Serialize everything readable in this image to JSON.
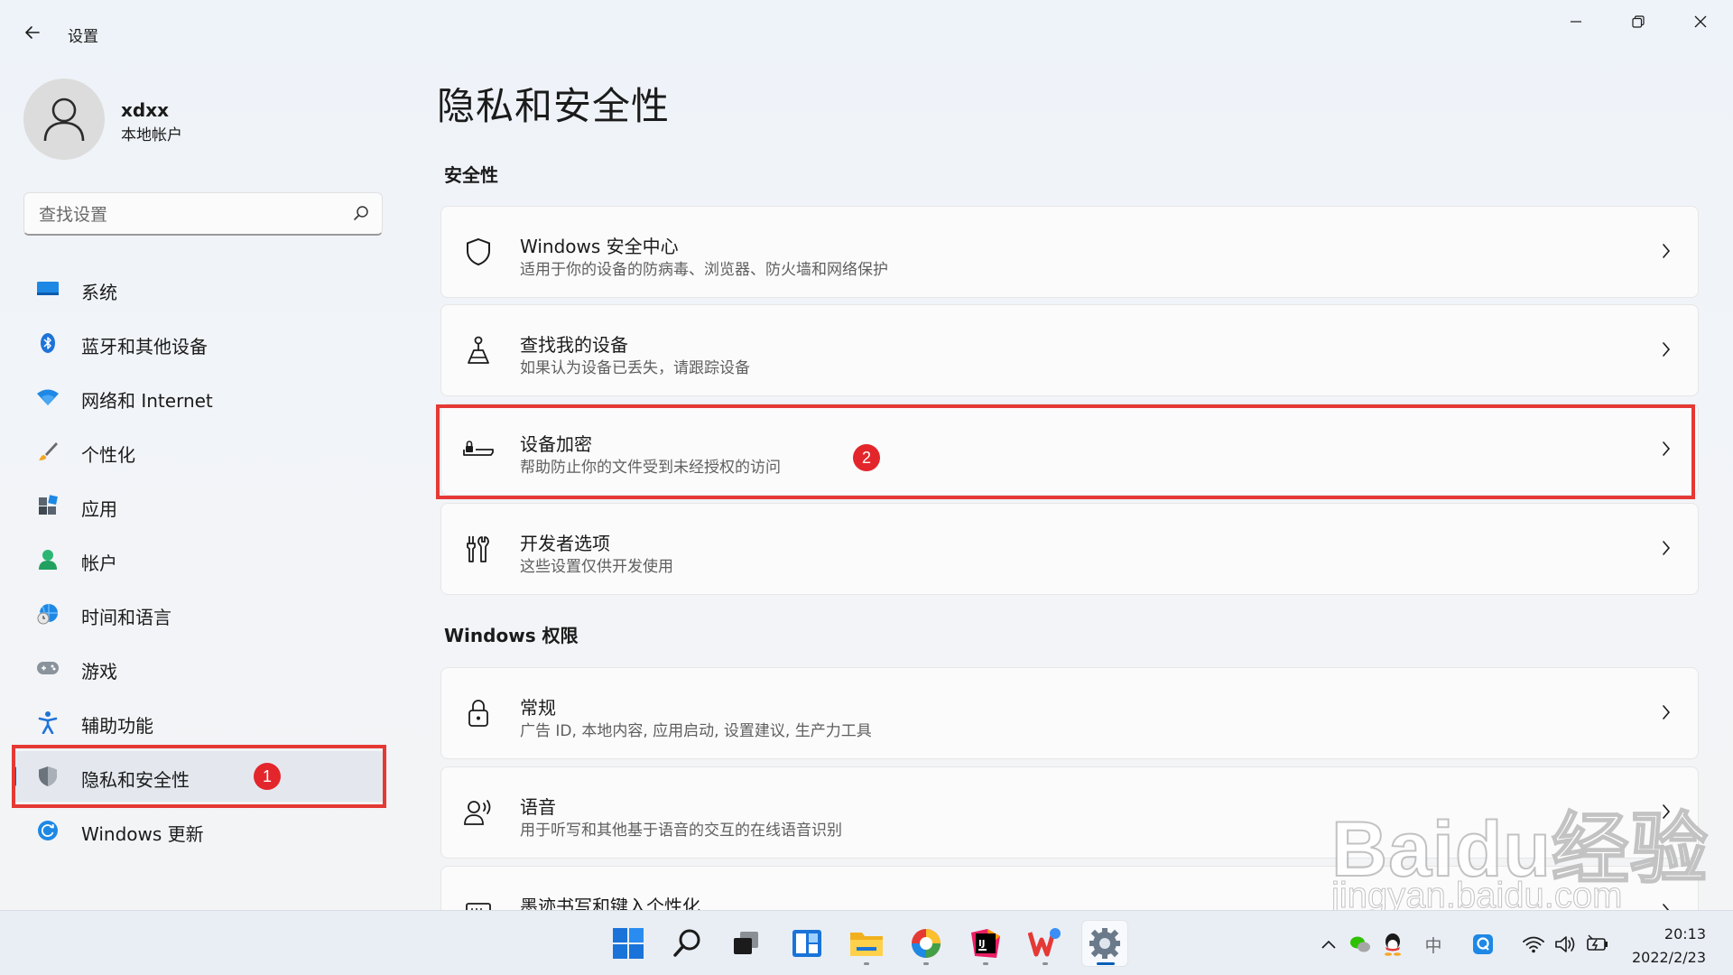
{
  "window": {
    "title": "设置",
    "back_icon": "back-arrow-icon",
    "controls": [
      "minimize-icon",
      "restore-icon",
      "close-icon"
    ]
  },
  "profile": {
    "name": "xdxx",
    "account_type": "本地帐户"
  },
  "search": {
    "placeholder": "查找设置"
  },
  "nav": {
    "items": [
      {
        "label": "系统",
        "icon": "system-display-icon"
      },
      {
        "label": "蓝牙和其他设备",
        "icon": "bluetooth-icon"
      },
      {
        "label": "网络和 Internet",
        "icon": "wifi-icon"
      },
      {
        "label": "个性化",
        "icon": "brush-icon"
      },
      {
        "label": "应用",
        "icon": "apps-icon"
      },
      {
        "label": "帐户",
        "icon": "account-icon"
      },
      {
        "label": "时间和语言",
        "icon": "globe-clock-icon"
      },
      {
        "label": "游戏",
        "icon": "gamepad-icon"
      },
      {
        "label": "辅助功能",
        "icon": "accessibility-icon"
      },
      {
        "label": "隐私和安全性",
        "icon": "shield-icon"
      },
      {
        "label": "Windows 更新",
        "icon": "windows-update-icon"
      }
    ],
    "selected_index": 9
  },
  "main": {
    "title": "隐私和安全性",
    "sections": [
      {
        "title": "安全性",
        "cards": [
          {
            "title": "Windows 安全中心",
            "description": "适用于你的设备的防病毒、浏览器、防火墙和网络保护",
            "icon": "shield-outline-icon"
          },
          {
            "title": "查找我的设备",
            "description": "如果认为设备已丢失，请跟踪设备",
            "icon": "find-device-icon"
          },
          {
            "title": "设备加密",
            "description": "帮助防止你的文件受到未经授权的访问",
            "icon": "device-encryption-icon"
          },
          {
            "title": "开发者选项",
            "description": "这些设置仅供开发使用",
            "icon": "developer-tools-icon"
          }
        ]
      },
      {
        "title": "Windows 权限",
        "cards": [
          {
            "title": "常规",
            "description": "广告 ID, 本地内容, 应用启动, 设置建议, 生产力工具",
            "icon": "lock-icon"
          },
          {
            "title": "语音",
            "description": "用于听写和其他基于语音的交互的在线语音识别",
            "icon": "speech-icon"
          },
          {
            "title": "墨迹书写和键入个性化",
            "description": "",
            "icon": "ink-keyboard-icon"
          }
        ]
      }
    ]
  },
  "annotations": {
    "badge_1": "1",
    "badge_2": "2",
    "highlight_color": "#e53935"
  },
  "watermark": {
    "brand": "Baidu经验",
    "url": "jingyan.baidu.com"
  },
  "taskbar": {
    "apps": [
      "windows-start-icon",
      "search-icon",
      "task-view-icon",
      "widgets-icon",
      "file-explorer-icon",
      "browser-icon",
      "intellij-icon",
      "wps-icon",
      "settings-gear-icon"
    ],
    "tray": [
      "chevron-up-icon",
      "wechat-icon",
      "qq-icon"
    ],
    "ime": "中",
    "tray_right": [
      "qq-q-icon",
      "wifi-icon",
      "volume-icon",
      "battery-icon"
    ],
    "time": "20:13",
    "date": "2022/2/23"
  },
  "colors": {
    "accent": "#005fb8",
    "background": "#f3f4f6",
    "card": "#fbfbfb"
  }
}
